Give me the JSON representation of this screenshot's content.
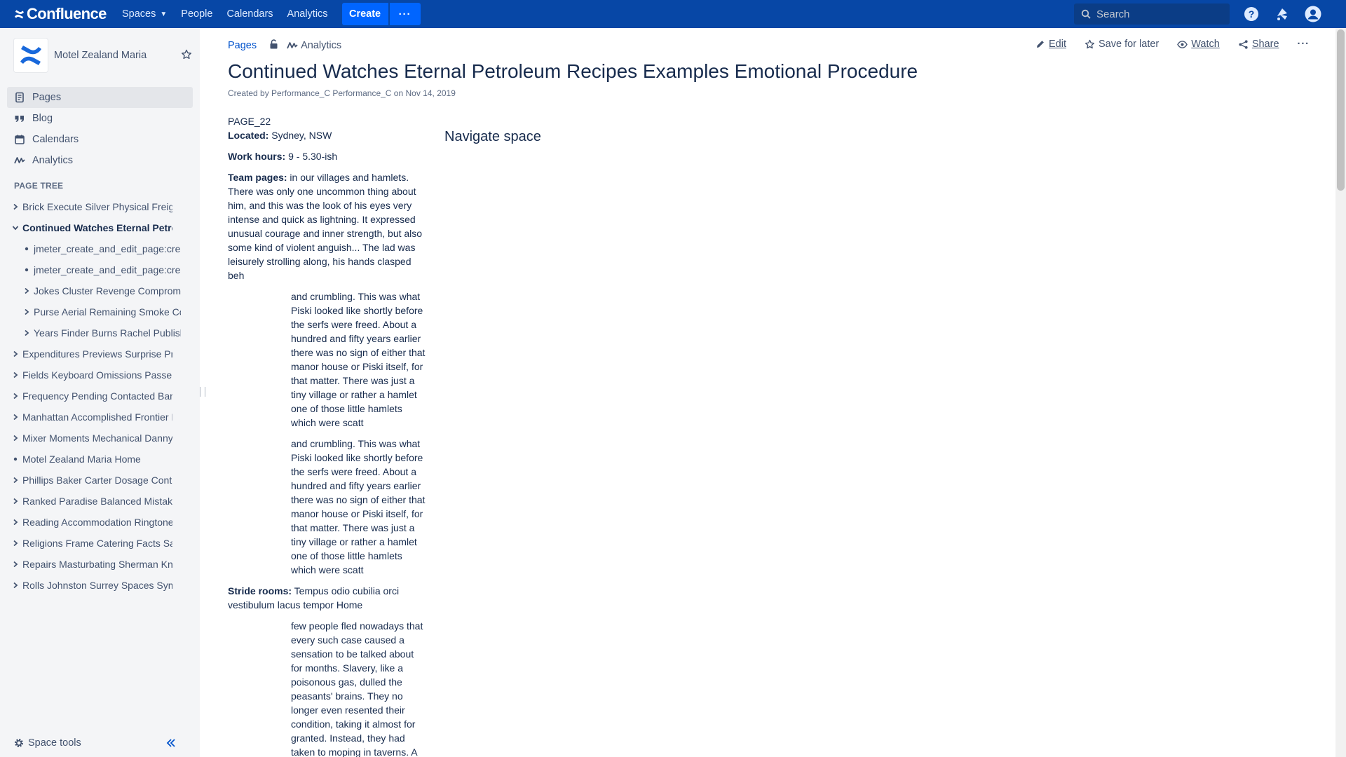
{
  "topnav": {
    "logo_text": "Confluence",
    "items": [
      "Spaces",
      "People",
      "Calendars",
      "Analytics"
    ],
    "create_label": "Create",
    "more_label": "···",
    "search_placeholder": "Search",
    "colors": {
      "bar": "#0747a6",
      "create": "#0065ff"
    }
  },
  "sidebar": {
    "space_name": "Motel Zealand Maria",
    "nav": [
      {
        "label": "Pages",
        "icon": "pages-icon",
        "active": true
      },
      {
        "label": "Blog",
        "icon": "quote-icon"
      },
      {
        "label": "Calendars",
        "icon": "calendar-icon"
      },
      {
        "label": "Analytics",
        "icon": "analytics-icon"
      }
    ],
    "tree_heading": "PAGE TREE",
    "tree": [
      {
        "label": "Brick Execute Silver Physical Freight",
        "level": 0,
        "type": "collapsed"
      },
      {
        "label": "Continued Watches Eternal Petroleum Recipes Examples Emotional Procedure",
        "level": 0,
        "type": "expanded",
        "current": true
      },
      {
        "label": "jmeter_create_and_edit_page:create_page",
        "level": 1,
        "type": "leaf"
      },
      {
        "label": "jmeter_create_and_edit_page:create_page",
        "level": 1,
        "type": "leaf"
      },
      {
        "label": "Jokes Cluster Revenge Compromise",
        "level": 1,
        "type": "collapsed"
      },
      {
        "label": "Purse Aerial Remaining Smoke Columns",
        "level": 1,
        "type": "collapsed"
      },
      {
        "label": "Years Finder Burns Rachel Published",
        "level": 1,
        "type": "collapsed"
      },
      {
        "label": "Expenditures Previews Surprise Preserve",
        "level": 0,
        "type": "collapsed"
      },
      {
        "label": "Fields Keyboard Omissions Passenger",
        "level": 0,
        "type": "collapsed"
      },
      {
        "label": "Frequency Pending Contacted Barry",
        "level": 0,
        "type": "collapsed"
      },
      {
        "label": "Manhattan Accomplished Frontier Penalty",
        "level": 0,
        "type": "collapsed"
      },
      {
        "label": "Mixer Moments Mechanical Danny Lemon",
        "level": 0,
        "type": "collapsed"
      },
      {
        "label": "Motel Zealand Maria Home",
        "level": 0,
        "type": "leaf"
      },
      {
        "label": "Phillips Baker Carter Dosage Control",
        "level": 0,
        "type": "collapsed"
      },
      {
        "label": "Ranked Paradise Balanced Mistakes",
        "level": 0,
        "type": "collapsed"
      },
      {
        "label": "Reading Accommodation Ringtone Ideas",
        "level": 0,
        "type": "collapsed"
      },
      {
        "label": "Religions Frame Catering Facts Sample",
        "level": 0,
        "type": "collapsed"
      },
      {
        "label": "Repairs Masturbating Sherman Knight",
        "level": 0,
        "type": "collapsed"
      },
      {
        "label": "Rolls Johnston Surrey Spaces Symphony",
        "level": 0,
        "type": "collapsed"
      }
    ],
    "space_tools": "Space tools"
  },
  "page": {
    "breadcrumb": {
      "pages": "Pages",
      "analytics": "Analytics"
    },
    "actions": {
      "edit": "Edit",
      "save": "Save for later",
      "watch": "Watch",
      "share": "Share"
    },
    "title": "Continued Watches Eternal Petroleum Recipes Examples Emotional Procedure",
    "byline": {
      "prefix": "Created by",
      "author": "Performance_C Performance_C",
      "on": "on",
      "date": "Nov 14, 2019"
    },
    "body": {
      "page_id": "PAGE_22",
      "located_label": "Located:",
      "located_value": " Sydney, NSW",
      "hours_label": "Work hours:",
      "hours_value": " 9 - 5.30-ish",
      "team_label": "Team pages:",
      "team_value": " in our villages and hamlets. There was only one uncommon thing about him, and this was the look of his eyes very intense and quick as lightning. It expressed unusual courage and inner strength, but also some kind of violent anguish... The lad was leisurely strolling along, his hands clasped beh",
      "para1": "and crumbling. This was what Piski looked like shortly before the serfs were freed. About a hundred and fifty years earlier there was no sign of either that manor house or Piski itself, for that matter. There was just a tiny village or rather a hamlet one of those little hamlets which were scatt",
      "para2": "and crumbling. This was what Piski looked like shortly before the serfs were freed. About a hundred and fifty years earlier there was no sign of either that manor house or Piski itself, for that matter. There was just a tiny village or rather a hamlet one of those little hamlets which were scatt",
      "stride_label": "Stride rooms:",
      "stride_value": " Tempus odio cubilia orci vestibulum lacus tempor Home",
      "para3": "few people fled nowadays that every such case caused a sensation to be talked about for months. Slavery, like a poisonous gas, dulled the peasants' brains. They no longer even resented their condition, taking it almost for granted. Instead, they had taken to moping in taverns. A"
    },
    "navigate_heading": "Navigate space"
  }
}
